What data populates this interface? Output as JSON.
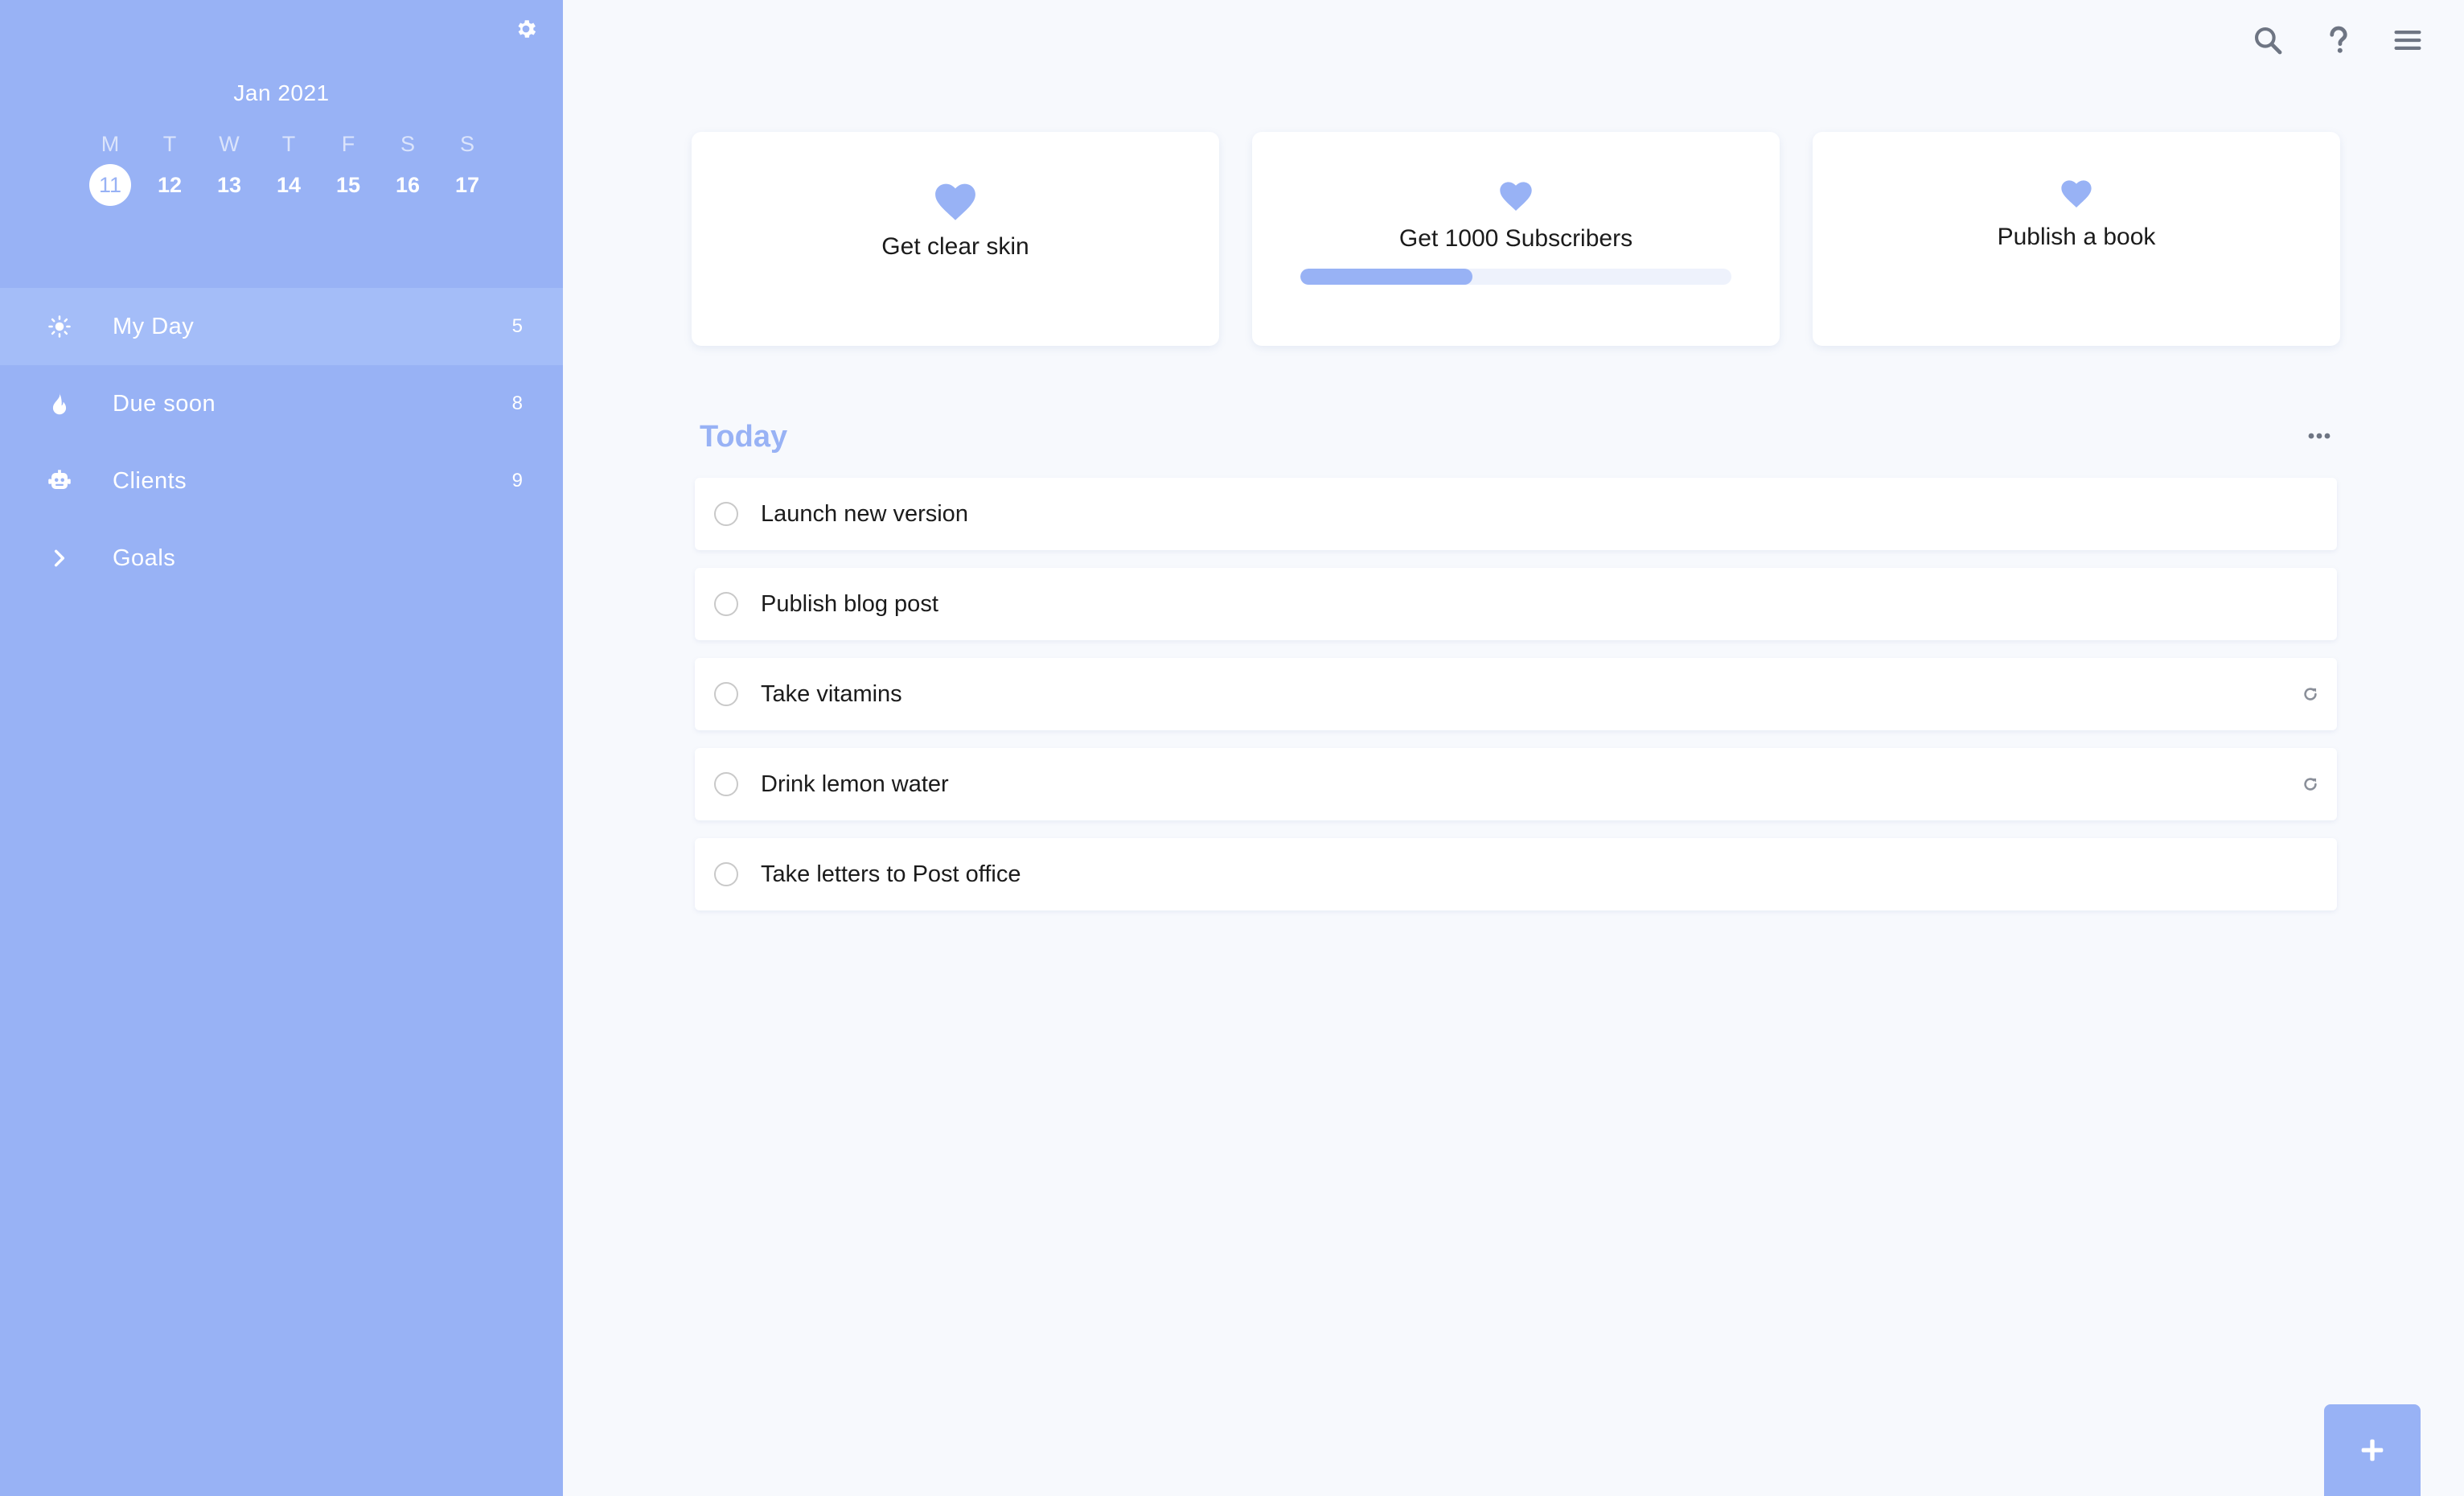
{
  "calendar": {
    "month_label": "Jan 2021",
    "weekdays": [
      "M",
      "T",
      "W",
      "T",
      "F",
      "S",
      "S"
    ],
    "dates": [
      "11",
      "12",
      "13",
      "14",
      "15",
      "16",
      "17"
    ],
    "selected_index": 0
  },
  "sidebar": {
    "items": [
      {
        "label": "My Day",
        "count": "5",
        "icon": "sun-icon",
        "active": true
      },
      {
        "label": "Due soon",
        "count": "8",
        "icon": "flame-icon"
      },
      {
        "label": "Clients",
        "count": "9",
        "icon": "robot-icon"
      },
      {
        "label": "Goals",
        "count": "",
        "icon": "chevron-right-icon"
      }
    ]
  },
  "toolbar": {
    "icons": [
      "search-icon",
      "help-icon",
      "menu-icon"
    ]
  },
  "goals": [
    {
      "title": "Get clear skin"
    },
    {
      "title": "Get 1000 Subscribers",
      "progress": 0.4
    },
    {
      "title": "Publish a book"
    }
  ],
  "today": {
    "title": "Today",
    "tasks": [
      {
        "text": "Launch new version",
        "repeat": false
      },
      {
        "text": "Publish blog post",
        "repeat": false
      },
      {
        "text": "Take vitamins",
        "repeat": true
      },
      {
        "text": "Drink lemon water",
        "repeat": true
      },
      {
        "text": "Take letters to Post office",
        "repeat": false
      }
    ]
  },
  "colors": {
    "accent": "#98b2f5",
    "sidebar_active": "#a4bdf8",
    "icon_gray": "#6e7583",
    "background": "#f7f9fd"
  }
}
